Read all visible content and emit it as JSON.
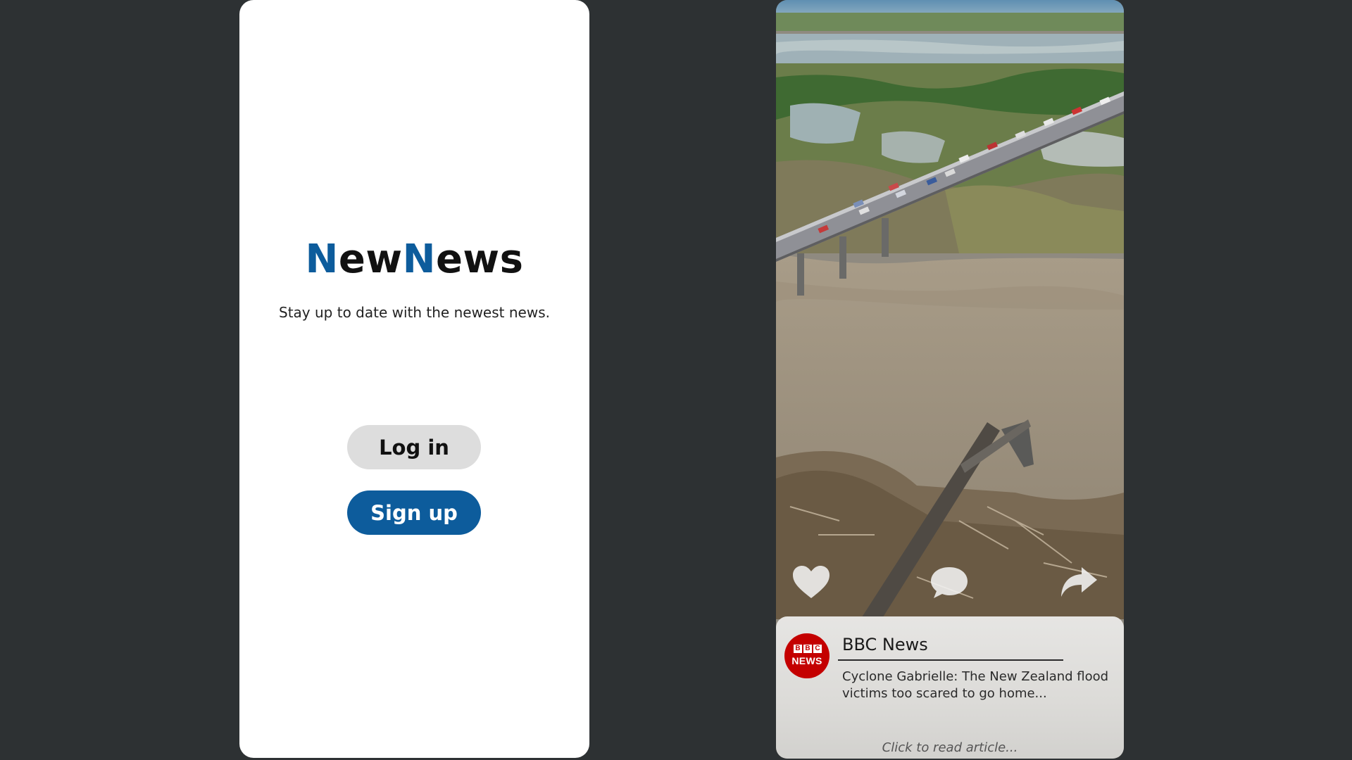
{
  "auth": {
    "logo_part1_cap": "N",
    "logo_part1_rest": "ew",
    "logo_part2_cap": "N",
    "logo_part2_rest": "ews",
    "tagline": "Stay up to date with the newest news.",
    "login_label": "Log in",
    "signup_label": "Sign up"
  },
  "feed": {
    "actions": [
      "heart-icon",
      "comment-icon",
      "share-icon"
    ],
    "card": {
      "source_logo_blocks": [
        "B",
        "B",
        "C"
      ],
      "source_logo_word": "NEWS",
      "source_name": "BBC News",
      "headline": "Cyclone Gabrielle: The New Zealand flood victims too scared to go home...",
      "read_hint": "Click to read article..."
    }
  },
  "colors": {
    "background": "#2d3133",
    "brand_blue": "#0d5c9c",
    "bbc_red": "#c40000",
    "button_grey": "#dddddd"
  }
}
